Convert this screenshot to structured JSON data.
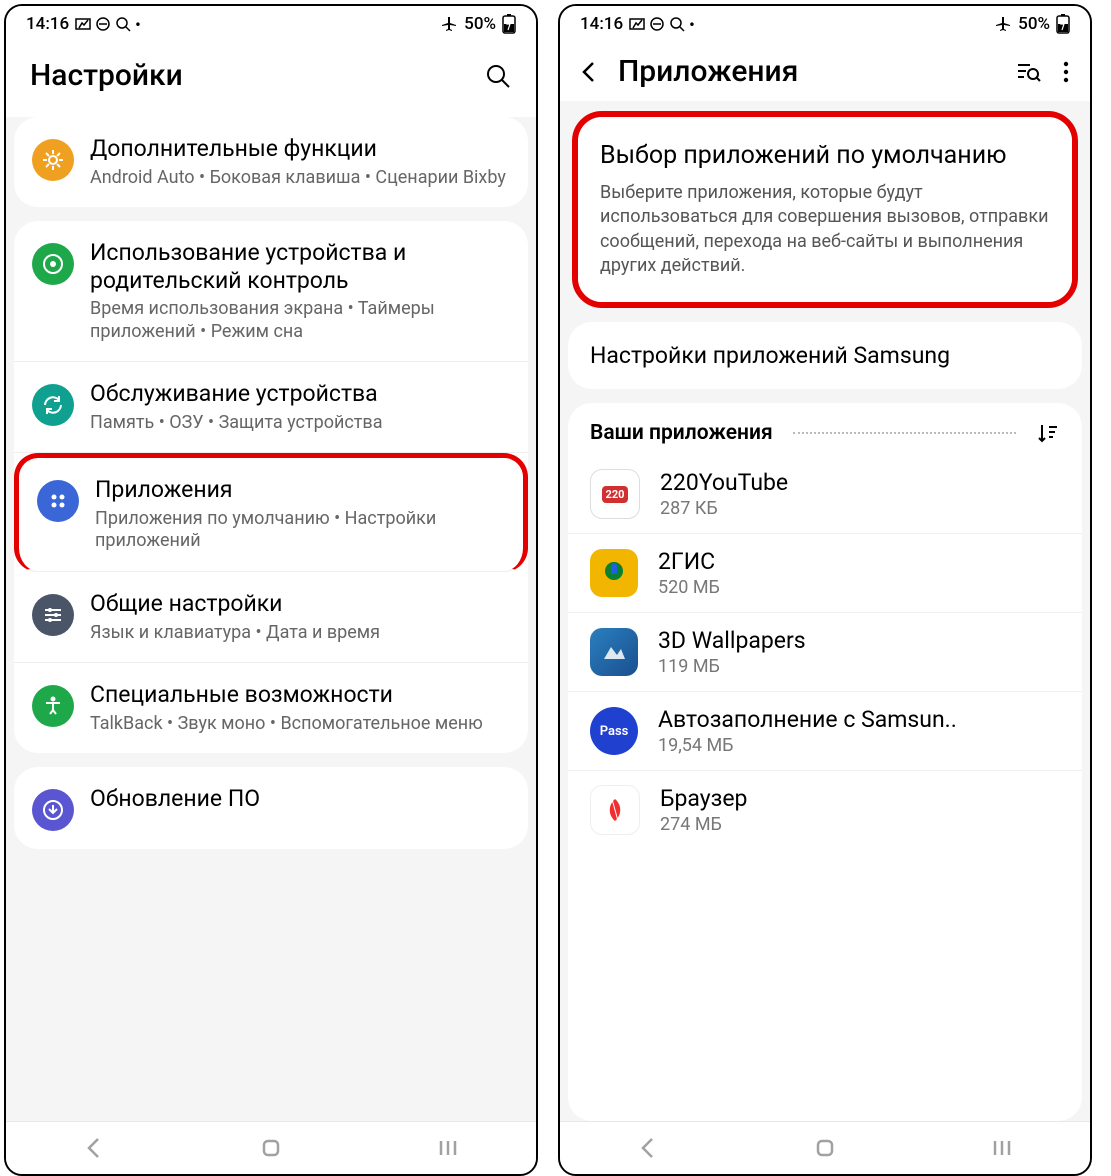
{
  "status": {
    "time": "14:16",
    "battery": "50%"
  },
  "phone1": {
    "header_title": "Настройки",
    "rows": [
      {
        "title": "Дополнительные функции",
        "sub": "Android Auto  •  Боковая клавиша  •  Сценарии Bixby",
        "icon_bg": "#f0a020",
        "icon_name": "gear-plus-icon"
      },
      {
        "title": "Использование устройства и родительский контроль",
        "sub": "Время использования экрана  •  Таймеры приложений  •  Режим сна",
        "icon_bg": "#1fa84a",
        "icon_name": "target-icon"
      },
      {
        "title": "Обслуживание устройства",
        "sub": "Память  •  ОЗУ  •  Защита устройства",
        "icon_bg": "#0fa090",
        "icon_name": "refresh-icon"
      },
      {
        "title": "Приложения",
        "sub": "Приложения по умолчанию  •  Настройки приложений",
        "icon_bg": "#3a66d8",
        "icon_name": "apps-grid-icon"
      },
      {
        "title": "Общие настройки",
        "sub": "Язык и клавиатура  •  Дата и время",
        "icon_bg": "#4a5568",
        "icon_name": "sliders-icon"
      },
      {
        "title": "Специальные возможности",
        "sub": "TalkBack  •  Звук моно  •  Вспомогательное меню",
        "icon_bg": "#1fa84a",
        "icon_name": "accessibility-icon"
      },
      {
        "title": "Обновление ПО",
        "sub": "",
        "icon_bg": "#5a55d0",
        "icon_name": "download-icon"
      }
    ]
  },
  "phone2": {
    "header_title": "Приложения",
    "default_apps": {
      "title": "Выбор приложений по умолчанию",
      "desc": "Выберите приложения, которые будут использоваться для совершения вызовов, отправки сообщений, перехода на веб-сайты и выполнения других действий."
    },
    "samsung_settings": "Настройки приложений Samsung",
    "apps_section_label": "Ваши приложения",
    "apps": [
      {
        "name": "220YouTube",
        "size": "287 КБ",
        "icon_bg": "#fff",
        "badge": "220"
      },
      {
        "name": "2ГИС",
        "size": "520 МБ",
        "icon_bg": "#f2b600"
      },
      {
        "name": "3D Wallpapers",
        "size": "119 МБ",
        "icon_bg": "#2a7fbf"
      },
      {
        "name": "Автозаполнение с Samsun..",
        "size": "19,54 МБ",
        "icon_bg": "#2040d0",
        "label": "Pass"
      },
      {
        "name": "Браузер",
        "size": "274 МБ",
        "icon_bg": "#fff"
      }
    ]
  }
}
